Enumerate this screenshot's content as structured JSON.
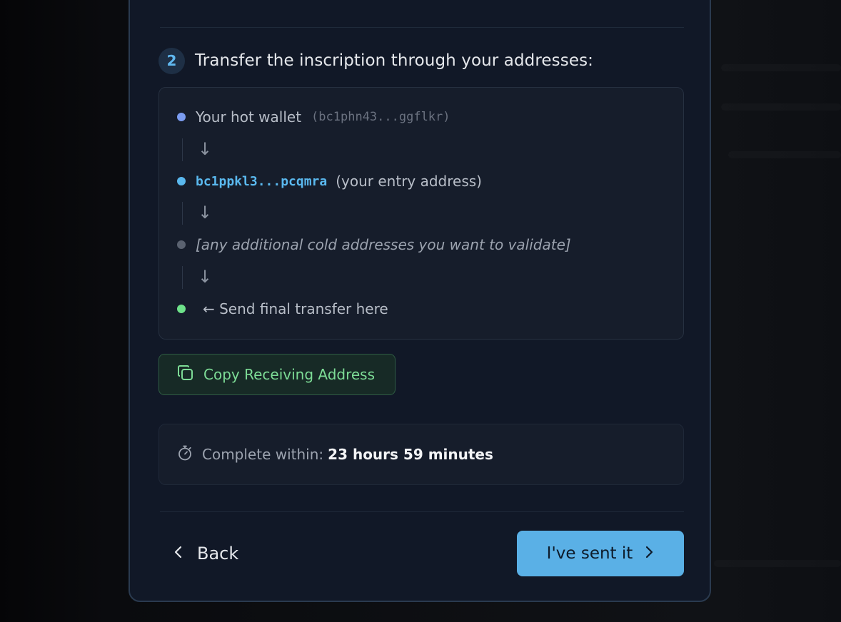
{
  "step": {
    "number": "2",
    "title": "Transfer the inscription through your addresses:"
  },
  "flow": {
    "hot_wallet_label": "Your hot wallet",
    "hot_wallet_address": "(bc1phn43...ggflkr)",
    "entry_address": "bc1ppkl3...pcqmra",
    "entry_note": "(your entry address)",
    "additional_note": "[any additional cold addresses you want to validate]",
    "final_note": "← Send final transfer here",
    "arrow": "↓",
    "dot_colors": {
      "hot_wallet": "#7b9cf0",
      "entry": "#5ab8ee",
      "additional": "#5a6270",
      "final": "#6ee28a"
    }
  },
  "copy_button": {
    "label": "Copy Receiving Address",
    "icon": "copy-icon"
  },
  "timer": {
    "icon": "stopwatch-icon",
    "label": "Complete within:",
    "value": "23 hours 59 minutes"
  },
  "footer": {
    "back_label": "Back",
    "back_icon": "chevron-left-icon",
    "primary_label": "I've sent it",
    "primary_icon": "chevron-right-icon"
  },
  "colors": {
    "accent": "#5ab0e6",
    "success": "#7ddc96",
    "modal_bg": "#111827",
    "modal_border": "#2a3a4f"
  }
}
